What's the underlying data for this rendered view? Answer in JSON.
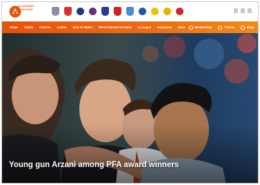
{
  "brand": {
    "logo_text_line1": "AA WOMEN",
    "logo_text_line2": "A-LEAGUE",
    "accent_color": "#e8520b"
  },
  "clubs": [
    {
      "icon": "club-crest-icon",
      "color": "#8a8fa3"
    },
    {
      "icon": "club-crest-icon",
      "color": "#d8302b"
    },
    {
      "icon": "club-crest-icon",
      "color": "#1d3b78"
    },
    {
      "icon": "club-crest-icon",
      "color": "#6a2f7a"
    },
    {
      "icon": "club-crest-icon",
      "color": "#23408e"
    },
    {
      "icon": "club-crest-icon",
      "color": "#c9242b"
    },
    {
      "icon": "club-crest-icon",
      "color": "#4a8ccd"
    },
    {
      "icon": "club-crest-icon",
      "color": "#1f57a6"
    },
    {
      "icon": "club-crest-icon",
      "color": "#f2c200"
    },
    {
      "icon": "club-crest-icon",
      "color": "#e9b100"
    },
    {
      "icon": "club-crest-icon",
      "color": "#d7262b"
    }
  ],
  "nav": {
    "items": [
      "Home",
      "Videos",
      "Fixtures",
      "Ladder",
      "How To Watch",
      "Where Heroes Are Made",
      "A-League",
      "Expansion",
      "More"
    ],
    "membership_label": "Membership",
    "tickets_label": "Tickets",
    "shop_label": "Shop"
  },
  "hero": {
    "headline": "Young gun Arzani among PFA award winners"
  }
}
